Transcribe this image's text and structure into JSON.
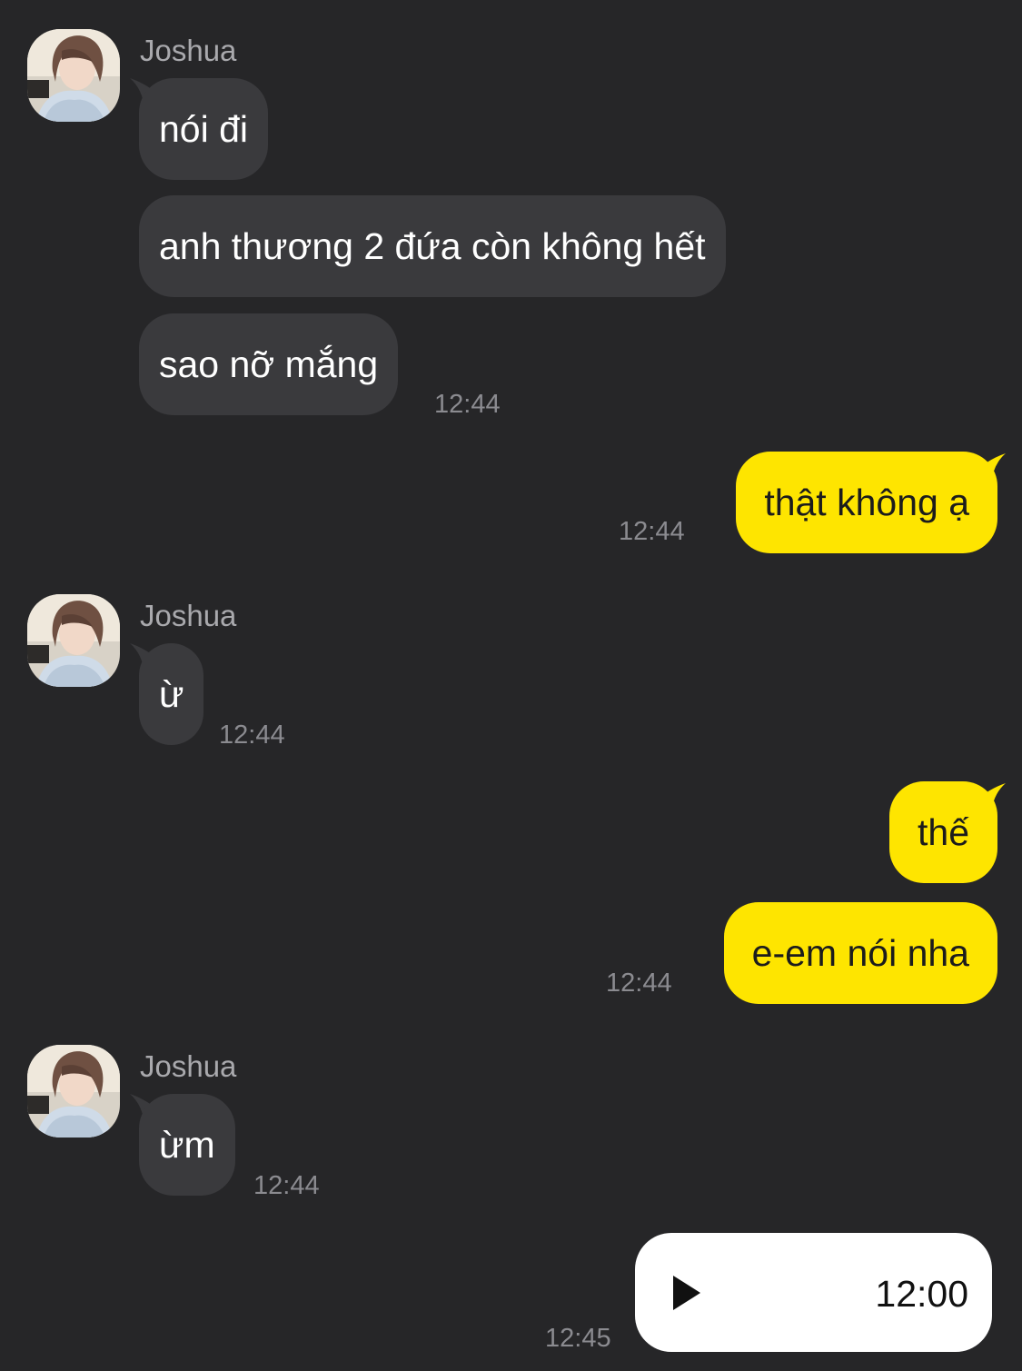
{
  "chat": {
    "background_color": "#262628",
    "colors": {
      "incoming_bubble": "#3a3a3d",
      "outgoing_bubble": "#fee500",
      "voice_bubble": "#ffffff",
      "timestamp": "#8b8b90"
    },
    "groups": [
      {
        "sender": "Joshua",
        "direction": "incoming",
        "avatar": "profile-photo",
        "messages": [
          "nói đi",
          "anh thương 2 đứa còn không hết",
          "sao nỡ mắng"
        ],
        "time": "12:44"
      },
      {
        "direction": "outgoing",
        "messages": [
          "thật không ạ"
        ],
        "time": "12:44"
      },
      {
        "sender": "Joshua",
        "direction": "incoming",
        "avatar": "profile-photo",
        "messages": [
          "ừ"
        ],
        "time": "12:44"
      },
      {
        "direction": "outgoing",
        "messages": [
          "thế",
          "e-em nói nha"
        ],
        "time": "12:44"
      },
      {
        "sender": "Joshua",
        "direction": "incoming",
        "avatar": "profile-photo",
        "messages": [
          "ừm"
        ],
        "time": "12:44"
      },
      {
        "direction": "outgoing",
        "type": "voice",
        "voice": {
          "icon": "play-icon",
          "duration": "12:00"
        },
        "time": "12:45"
      }
    ]
  }
}
